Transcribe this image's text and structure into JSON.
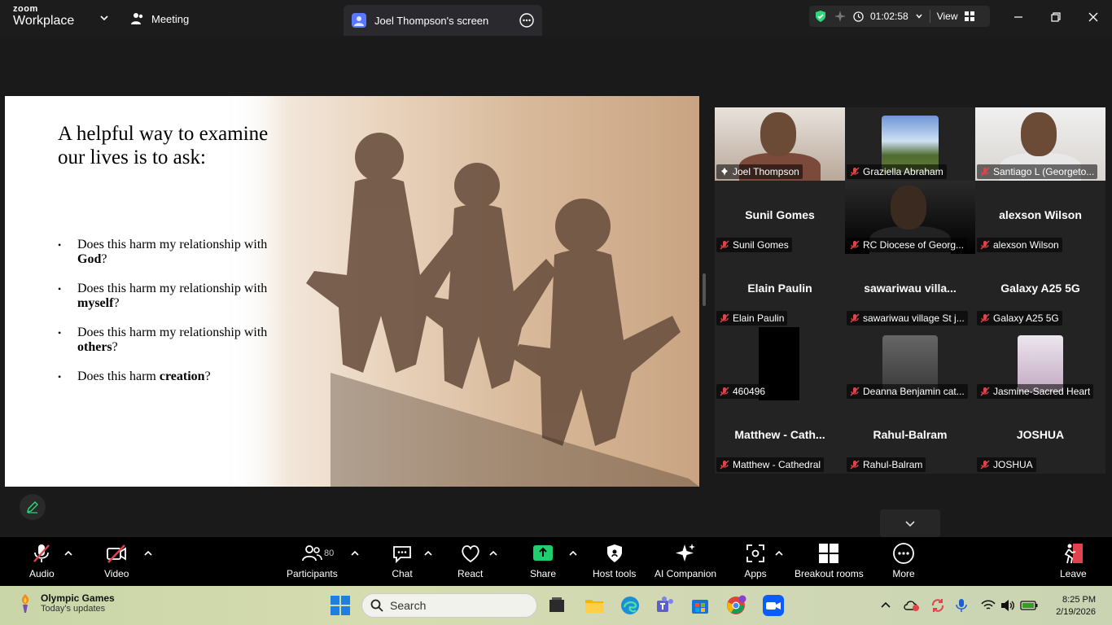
{
  "titlebar": {
    "logo_line1": "zoom",
    "logo_line2": "Workplace",
    "meeting_tab": "Meeting",
    "screen_tab": "Joel Thompson's screen",
    "timer": "01:02:58",
    "view": "View"
  },
  "slide": {
    "title": "A helpful way to examine our lives is to ask:",
    "bullets": [
      {
        "pre": "Does this harm my relationship with ",
        "bold": "God",
        "post": "?"
      },
      {
        "pre": "Does this harm my relationship with ",
        "bold": "myself",
        "post": "?"
      },
      {
        "pre": "Does this harm my relationship with ",
        "bold": "others",
        "post": "?"
      },
      {
        "pre": "Does this harm ",
        "bold": "creation",
        "post": "?"
      }
    ]
  },
  "participants": [
    {
      "name": "Joel Thompson",
      "center": "",
      "video": true,
      "active": true
    },
    {
      "name": "Graziella Abraham",
      "center": "",
      "video": true
    },
    {
      "name": "Santiago L (Georgeto...",
      "center": "",
      "video": true
    },
    {
      "name": "Sunil Gomes",
      "center": "Sunil Gomes"
    },
    {
      "name": "RC Diocese of Georg...",
      "center": "",
      "video": true
    },
    {
      "name": "alexson Wilson",
      "center": "alexson Wilson"
    },
    {
      "name": "Elain Paulin",
      "center": "Elain Paulin"
    },
    {
      "name": "sawariwau village St j...",
      "center": "sawariwau  villa..."
    },
    {
      "name": "Galaxy A25 5G",
      "center": "Galaxy A25 5G"
    },
    {
      "name": "460496",
      "center": "",
      "video": true
    },
    {
      "name": "Deanna Benjamin cat...",
      "center": "",
      "video": true
    },
    {
      "name": "Jasmine-Sacred Heart",
      "center": "",
      "video": true
    },
    {
      "name": "Matthew - Cathedral",
      "center": "Matthew - Cath..."
    },
    {
      "name": "Rahul-Balram",
      "center": "Rahul-Balram"
    },
    {
      "name": "JOSHUA",
      "center": "JOSHUA"
    }
  ],
  "toolbar": {
    "audio": "Audio",
    "video": "Video",
    "participants": "Participants",
    "participants_count": "80",
    "chat": "Chat",
    "react": "React",
    "share": "Share",
    "host_tools": "Host tools",
    "ai_companion": "AI Companion",
    "apps": "Apps",
    "breakout": "Breakout rooms",
    "more": "More",
    "leave": "Leave"
  },
  "taskbar": {
    "weather_title": "Olympic Games",
    "weather_sub": "Today's updates",
    "search_placeholder": "Search",
    "time": "8:25 PM",
    "date": "2/19/2026"
  },
  "colors": {
    "accent_green": "#2ed87a",
    "muted_red": "#e0434b",
    "share_green": "#1fcf6f"
  }
}
